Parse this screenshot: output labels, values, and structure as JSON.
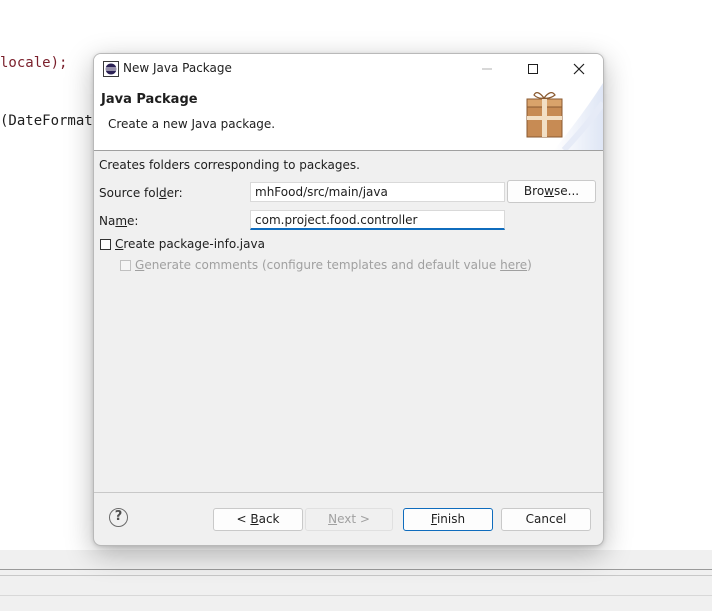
{
  "editor": {
    "line1": "locale);",
    "line2": "(DateFormat"
  },
  "dialog": {
    "title": "New Java Package",
    "banner_title": "Java Package",
    "banner_description": "Create a new Java package.",
    "info": "Creates folders corresponding to packages.",
    "source_folder": {
      "label_pre": "Source fol",
      "label_mnemonic": "d",
      "label_post": "er:",
      "value": "mhFood/src/main/java"
    },
    "browse_label_pre": "Bro",
    "browse_label_mnemonic": "w",
    "browse_label_post": "se...",
    "name": {
      "label_pre": "Na",
      "label_mnemonic": "m",
      "label_post": "e:",
      "value": "com.project.food.controller"
    },
    "create_info": {
      "mnemonic": "C",
      "label": "reate package-info.java",
      "checked": false
    },
    "generate_comments": {
      "mnemonic": "G",
      "label": "enerate comments",
      "suffix": " (configure templates and default value ",
      "link": "here",
      "close": ")",
      "checked": false,
      "enabled": false
    },
    "buttons": {
      "back_pre": "< ",
      "back_mnemonic": "B",
      "back_post": "ack",
      "next_mnemonic": "N",
      "next_post": "ext >",
      "finish_mnemonic": "F",
      "finish_post": "inish",
      "cancel": "Cancel"
    },
    "help_glyph": "?",
    "accent_color": "#0f6cbd"
  }
}
